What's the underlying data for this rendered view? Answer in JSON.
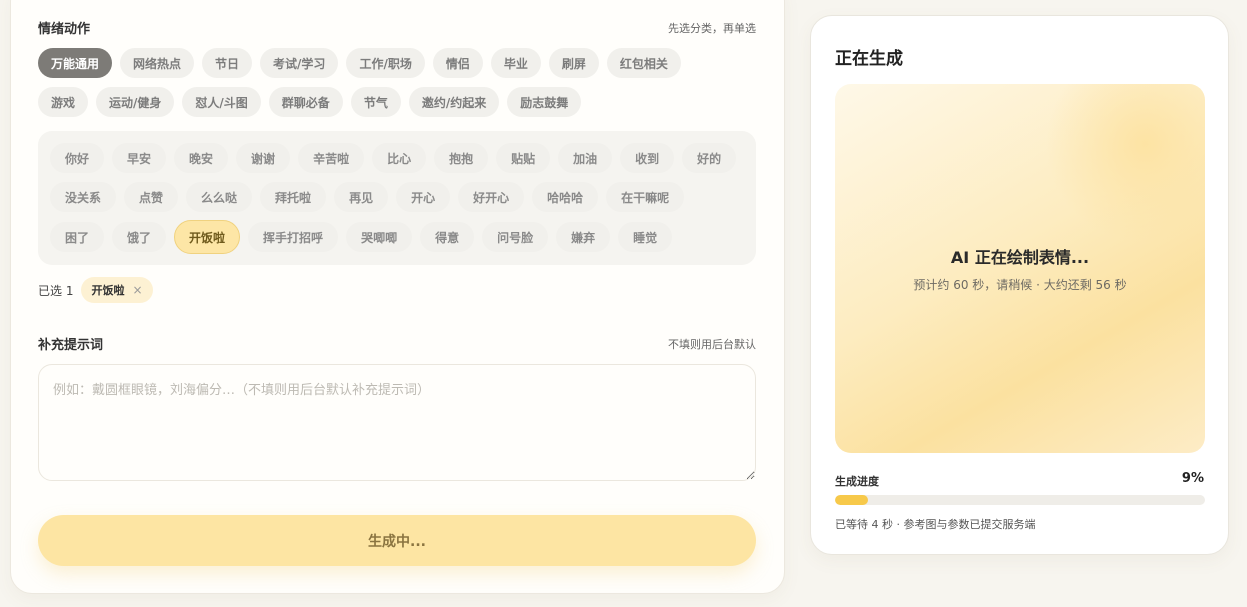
{
  "emotion": {
    "title": "情绪动作",
    "hint": "先选分类，再单选",
    "categories_row1": [
      "万能通用",
      "网络热点",
      "节日",
      "考试/学习",
      "工作/职场",
      "情侣",
      "毕业",
      "刷屏",
      "红包相关"
    ],
    "categories_row2": [
      "游戏",
      "运动/健身",
      "怼人/斗图",
      "群聊必备",
      "节气",
      "邀约/约起来",
      "励志鼓舞"
    ],
    "active_category": "万能通用",
    "actions_row1": [
      "你好",
      "早安",
      "晚安",
      "谢谢",
      "辛苦啦",
      "比心",
      "抱抱",
      "贴贴",
      "加油",
      "收到",
      "好的"
    ],
    "actions_row2": [
      "没关系",
      "点赞",
      "么么哒",
      "拜托啦",
      "再见",
      "开心",
      "好开心",
      "哈哈哈",
      "在干嘛呢"
    ],
    "actions_row3": [
      "困了",
      "饿了",
      "开饭啦",
      "挥手打招呼",
      "哭唧唧",
      "得意",
      "问号脸",
      "嫌弃",
      "睡觉"
    ],
    "selected_action": "开饭啦",
    "selected_count_text": "已选 1",
    "selected_tag": "开饭啦",
    "remove_glyph": "×"
  },
  "prompt": {
    "title": "补充提示词",
    "hint": "不填则用后台默认",
    "placeholder": "例如：戴圆框眼镜，刘海偏分…（不填则用后台默认补充提示词）",
    "value": ""
  },
  "generate_button": "生成中...",
  "panel": {
    "title": "正在生成",
    "preview_main": "AI 正在绘制表情...",
    "preview_sub": "预计约 60 秒，请稍候 · 大约还剩 56 秒",
    "progress_label": "生成进度",
    "progress_text": "9%",
    "progress_value": 0.09,
    "progress_note": "已等待 4 秒 · 参考图与参数已提交服务端"
  },
  "colors": {
    "accent": "#f7c94a",
    "selected_chip": "#fde6a6",
    "active_category": "#7d7b77"
  }
}
